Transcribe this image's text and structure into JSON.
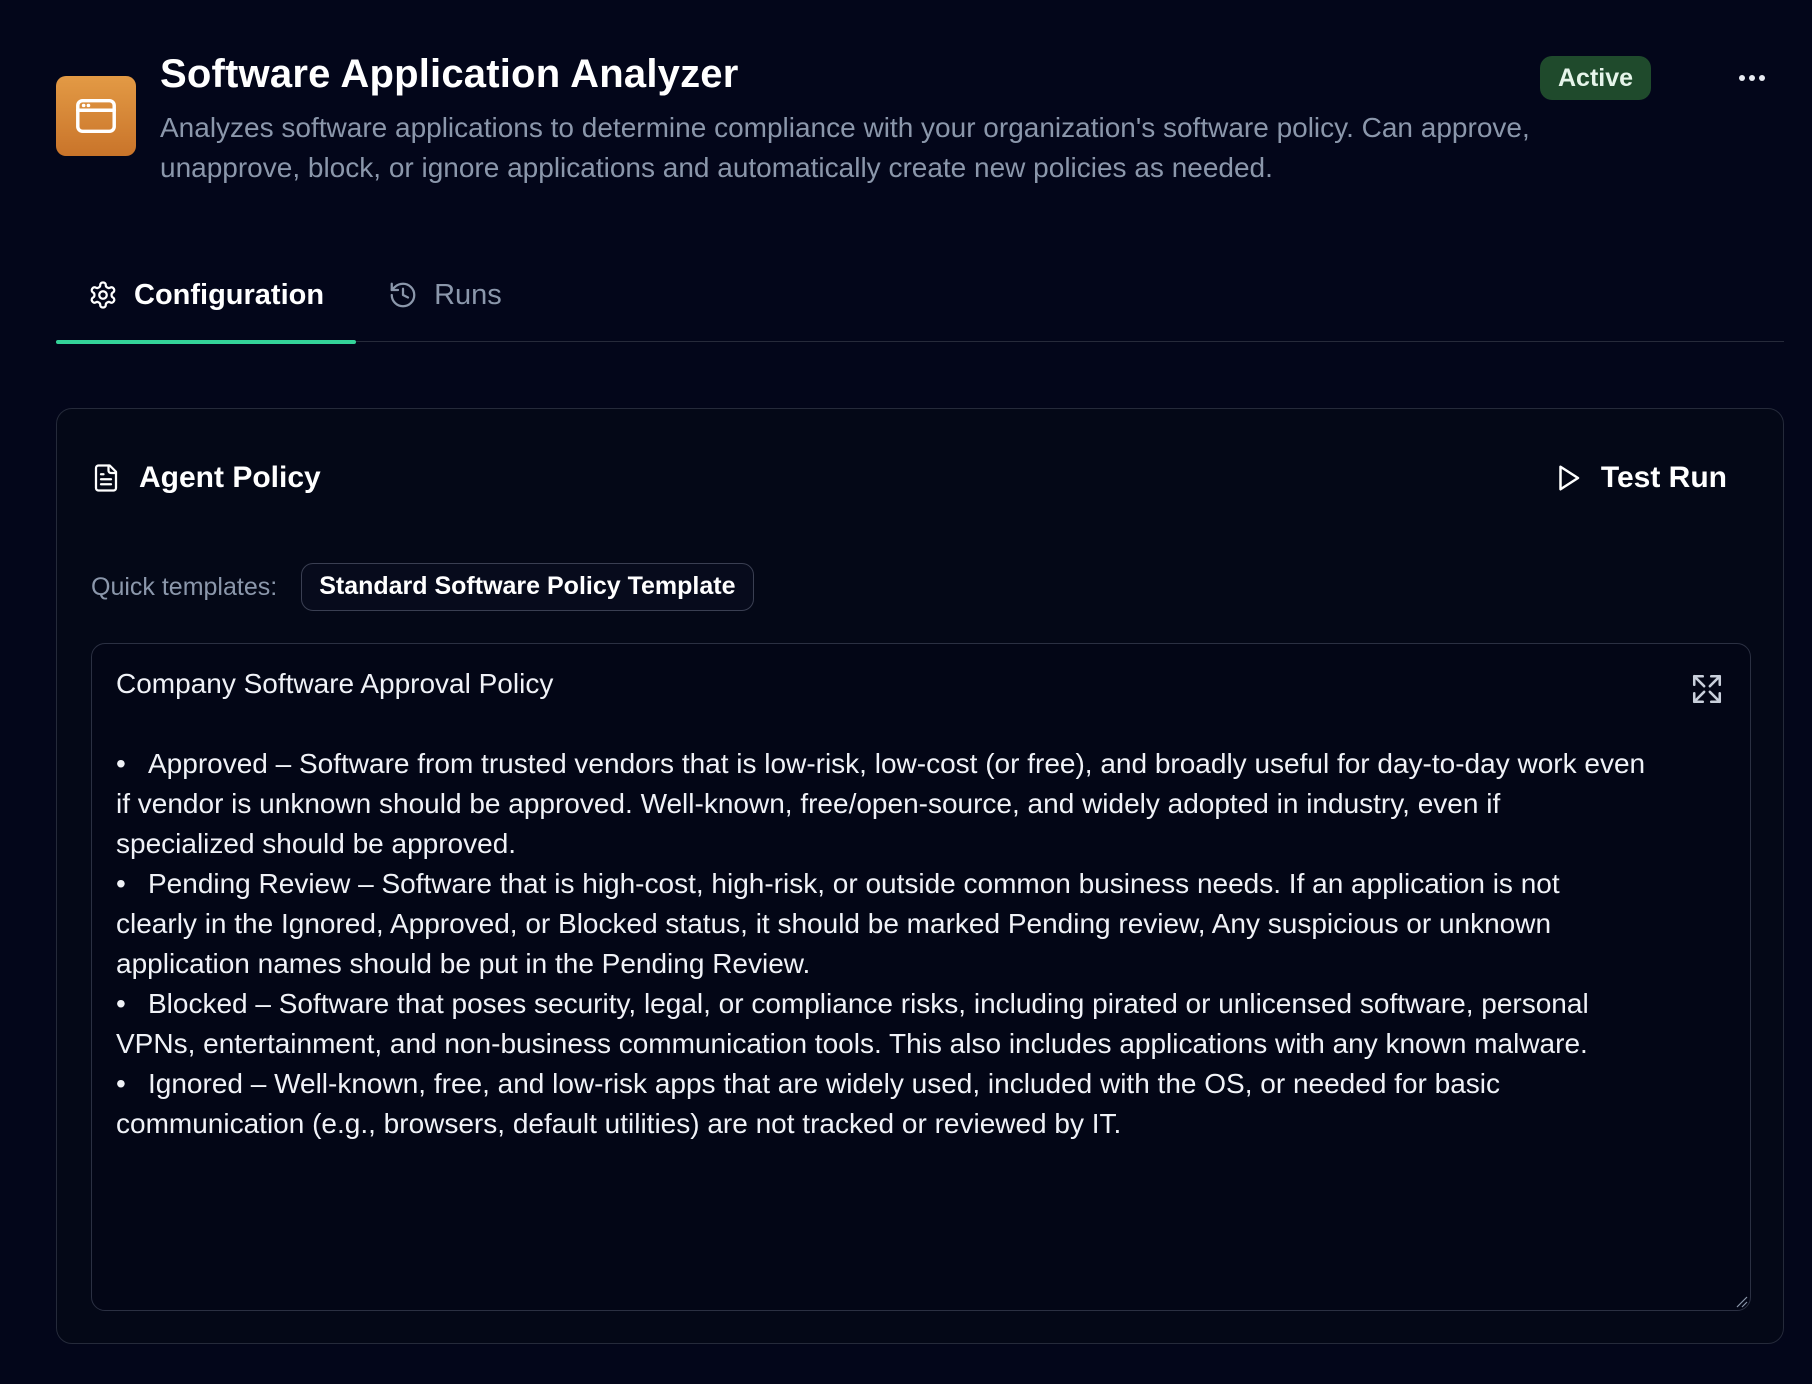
{
  "app": {
    "title": "Software Application Analyzer",
    "description": "Analyzes software applications to determine compliance with your organization's software policy. Can approve, unapprove, block, or ignore applications and automatically create new policies as needed.",
    "status": "Active",
    "icon": "app-window-icon",
    "accent_color": "#d8843a"
  },
  "tabs": [
    {
      "label": "Configuration",
      "icon": "gear-icon",
      "active": true
    },
    {
      "label": "Runs",
      "icon": "history-icon",
      "active": false
    }
  ],
  "card": {
    "title": "Agent Policy",
    "title_icon": "document-icon",
    "test_run_label": "Test Run",
    "quick_templates_label": "Quick templates:",
    "template_chip": "Standard Software Policy Template"
  },
  "policy": {
    "heading": "Company Software Approval Policy",
    "bullet": "•",
    "items": [
      "Approved – Software from trusted vendors that is low-risk, low-cost (or free), and broadly useful for day-to-day work even if vendor is unknown should be approved. Well-known, free/open-source, and widely adopted in industry, even if specialized should be approved.",
      "Pending Review – Software that is high-cost, high-risk, or outside common business needs. If an application is not clearly in the Ignored, Approved, or Blocked status, it should be marked Pending review, Any suspicious or unknown application names should be put in the Pending Review.",
      "Blocked – Software that poses security, legal, or compliance risks, including pirated or unlicensed software, personal VPNs, entertainment, and non-business communication tools. This also includes applications with any known malware.",
      "Ignored – Well-known, free, and low-risk apps that are widely used, included with the OS, or needed for basic communication (e.g., browsers, default utilities) are not tracked or reviewed by IT."
    ]
  },
  "colors": {
    "background": "#03061a",
    "tab_active_underline": "#34d399",
    "status_badge_bg": "#1f4a2c",
    "muted_text": "#8b97ab"
  }
}
